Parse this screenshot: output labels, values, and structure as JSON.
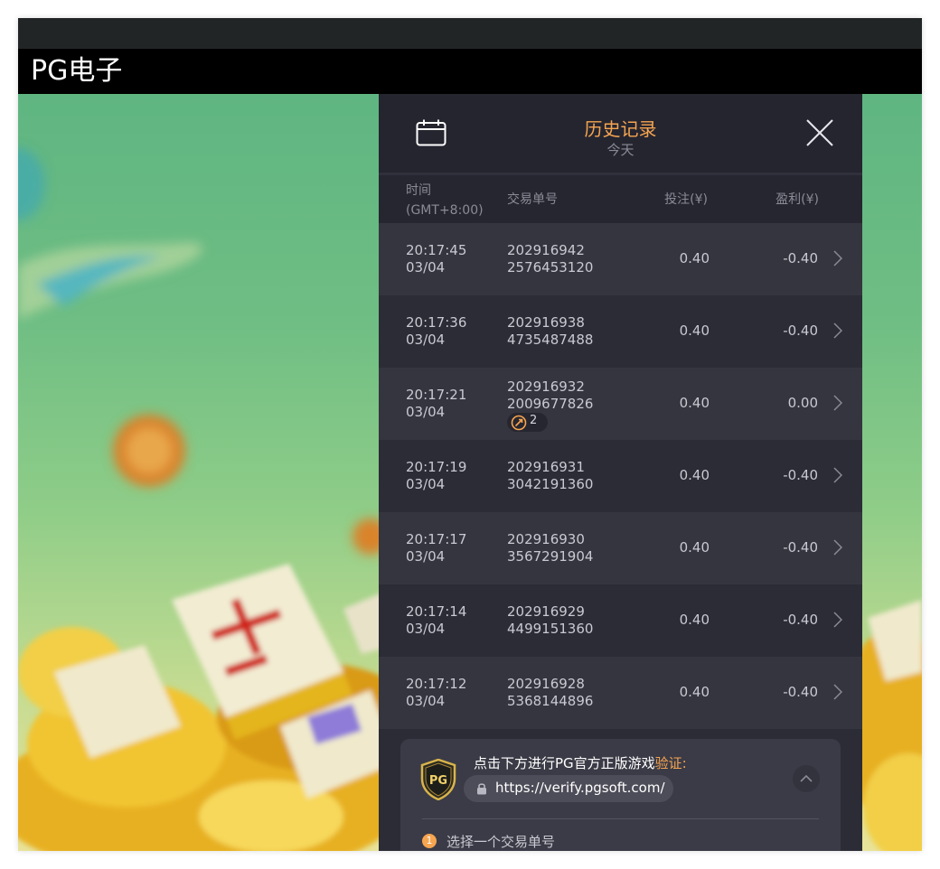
{
  "window": {
    "title": "PG电子"
  },
  "history": {
    "title": "历史记录",
    "subtitle": "今天",
    "columns": {
      "time": "时间",
      "timezone": "(GMT+8:00)",
      "txid": "交易单号",
      "bet": "投注(¥)",
      "profit": "盈利(¥)"
    },
    "rows": [
      {
        "time": "20:17:45",
        "date": "03/04",
        "tx1": "202916942",
        "tx2": "2576453120",
        "bet": "0.40",
        "profit": "-0.40"
      },
      {
        "time": "20:17:36",
        "date": "03/04",
        "tx1": "202916938",
        "tx2": "4735487488",
        "bet": "0.40",
        "profit": "-0.40"
      },
      {
        "time": "20:17:21",
        "date": "03/04",
        "tx1": "202916932",
        "tx2": "2009677826",
        "bet": "0.40",
        "profit": "0.00",
        "free_spins": "2"
      },
      {
        "time": "20:17:19",
        "date": "03/04",
        "tx1": "202916931",
        "tx2": "3042191360",
        "bet": "0.40",
        "profit": "-0.40"
      },
      {
        "time": "20:17:17",
        "date": "03/04",
        "tx1": "202916930",
        "tx2": "3567291904",
        "bet": "0.40",
        "profit": "-0.40"
      },
      {
        "time": "20:17:14",
        "date": "03/04",
        "tx1": "202916929",
        "tx2": "4499151360",
        "bet": "0.40",
        "profit": "-0.40"
      },
      {
        "time": "20:17:12",
        "date": "03/04",
        "tx1": "202916928",
        "tx2": "5368144896",
        "bet": "0.40",
        "profit": "-0.40"
      }
    ]
  },
  "verify": {
    "logo_text": "PG",
    "text_main": "点击下方进行PG官方正版游戏",
    "text_highlight": "验证:",
    "url": "https://verify.pgsoft.com/",
    "step_number": "1",
    "step_text": "选择一个交易单号"
  },
  "colors": {
    "accent": "#f6a550",
    "panel_bg": "#2c2c36",
    "row_alt": "#35353f",
    "title_bar": "#000000"
  }
}
